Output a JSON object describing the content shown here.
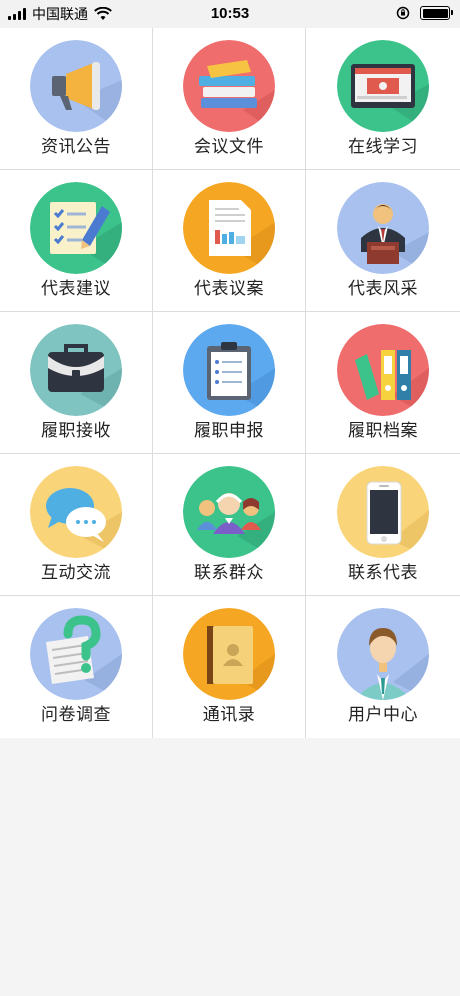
{
  "status_bar": {
    "carrier": "中国联通",
    "time": "10:53"
  },
  "menu": [
    {
      "label": "资讯公告",
      "icon": "megaphone-icon",
      "color": "#A9C1EE"
    },
    {
      "label": "会议文件",
      "icon": "books-icon",
      "color": "#EF6D6D"
    },
    {
      "label": "在线学习",
      "icon": "online-video-icon",
      "color": "#3CC38C"
    },
    {
      "label": "代表建议",
      "icon": "checklist-pencil-icon",
      "color": "#3CC38C"
    },
    {
      "label": "代表议案",
      "icon": "report-document-icon",
      "color": "#F5A623"
    },
    {
      "label": "代表风采",
      "icon": "speaker-at-podium-icon",
      "color": "#A9C1EE"
    },
    {
      "label": "履职接收",
      "icon": "briefcase-icon",
      "color": "#7FC4C0"
    },
    {
      "label": "履职申报",
      "icon": "clipboard-icon",
      "color": "#5DA9F0"
    },
    {
      "label": "履职档案",
      "icon": "binders-icon",
      "color": "#EF6D6D"
    },
    {
      "label": "互动交流",
      "icon": "chat-bubbles-icon",
      "color": "#F9D479"
    },
    {
      "label": "联系群众",
      "icon": "people-group-icon",
      "color": "#3CC38C"
    },
    {
      "label": "联系代表",
      "icon": "smartphone-icon",
      "color": "#F9D479"
    },
    {
      "label": "问卷调查",
      "icon": "questionnaire-icon",
      "color": "#A9C1EE"
    },
    {
      "label": "通讯录",
      "icon": "address-book-icon",
      "color": "#F5A623"
    },
    {
      "label": "用户中心",
      "icon": "user-avatar-icon",
      "color": "#A9C1EE"
    }
  ]
}
